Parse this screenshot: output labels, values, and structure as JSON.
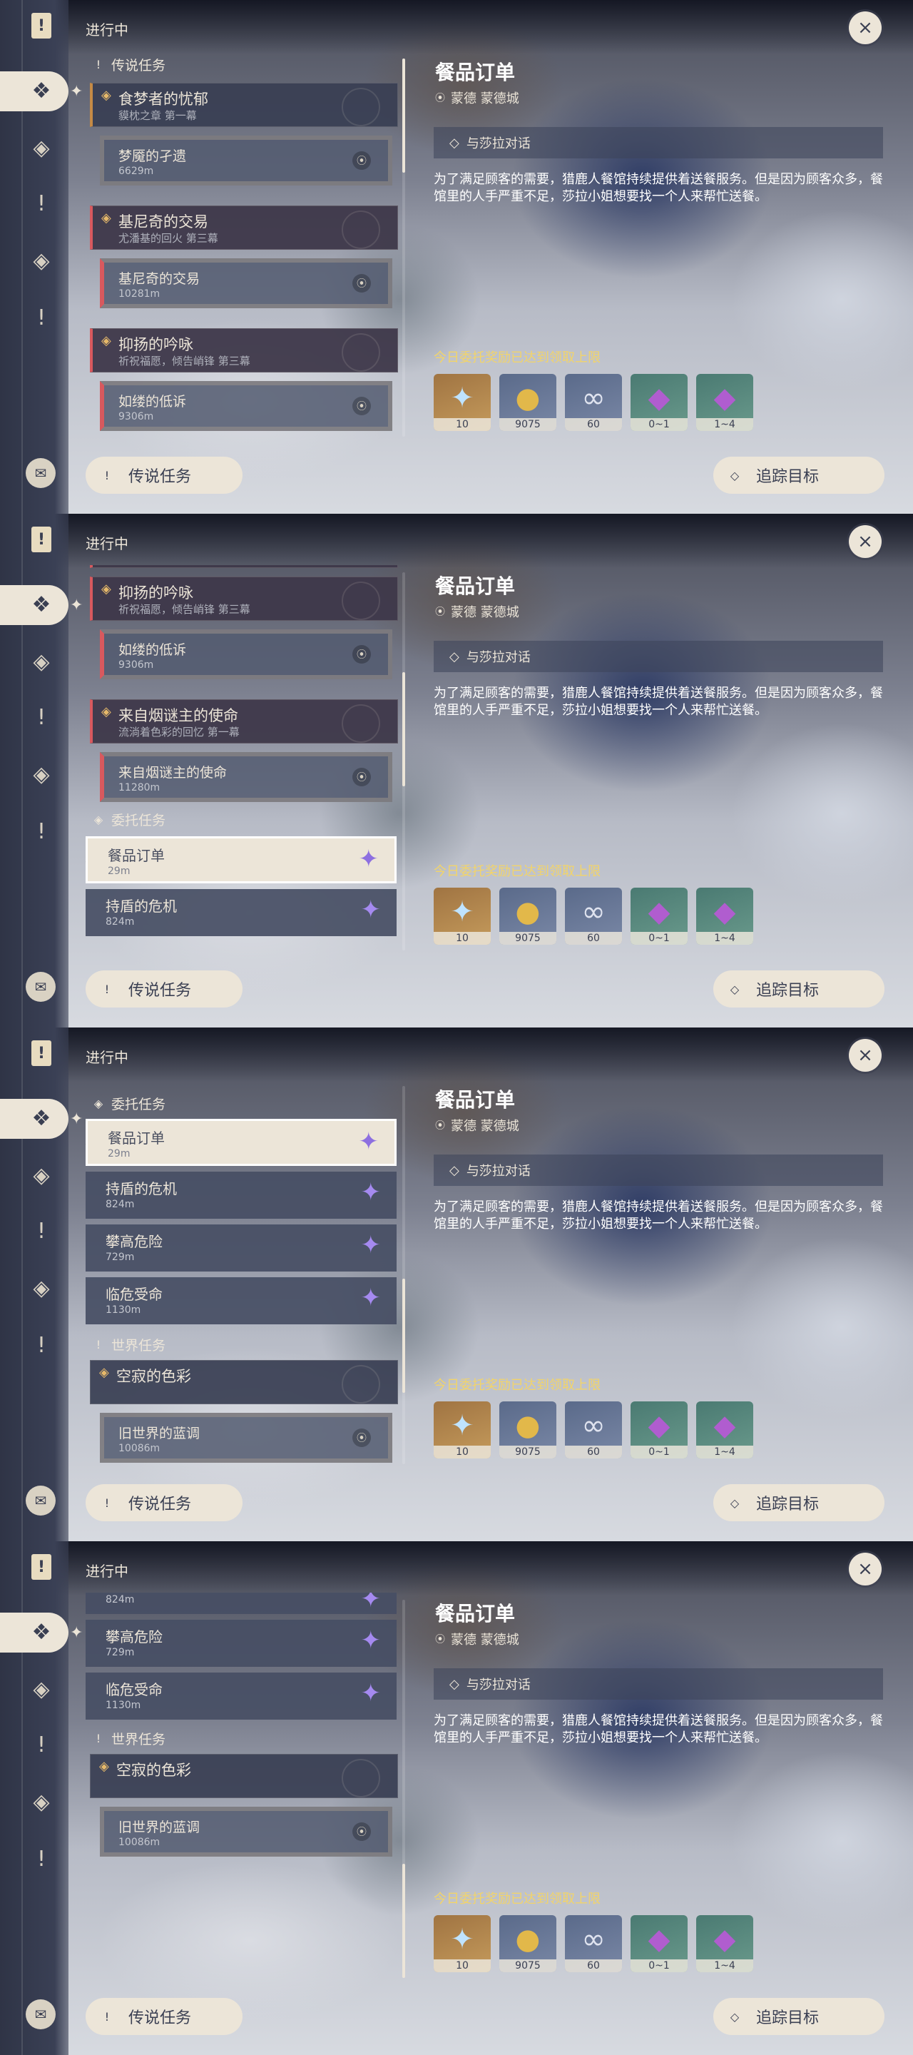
{
  "header": {
    "in_progress": "进行中",
    "close_icon": "×"
  },
  "categories": {
    "legend": "传说任务",
    "commission": "委托任务",
    "world": "世界任务"
  },
  "quests": {
    "q1": {
      "title": "食梦者的忧郁",
      "subtitle": "貘枕之章 第一幕",
      "step": "梦魇的孑遗",
      "dist": "6629m"
    },
    "q2": {
      "title": "基尼奇的交易",
      "subtitle": "尤潘基的回火 第三幕",
      "step": "基尼奇的交易",
      "dist": "10281m"
    },
    "q3": {
      "title": "抑扬的吟咏",
      "subtitle": "祈祝福愿，倾告峭锋 第三幕",
      "step": "如缕的低诉",
      "dist": "9306m"
    },
    "q4": {
      "title": "来自烟谜主的使命",
      "subtitle": "流淌着色彩的回忆 第一幕",
      "step": "来自烟谜主的使命",
      "dist": "11280m"
    },
    "w1": {
      "title": "空寂的色彩",
      "step": "旧世界的蓝调",
      "dist": "10086m"
    }
  },
  "commissions": [
    {
      "title": "餐品订单",
      "dist": "29m"
    },
    {
      "title": "持盾的危机",
      "dist": "824m"
    },
    {
      "title": "攀高危险",
      "dist": "729m"
    },
    {
      "title": "临危受命",
      "dist": "1130m"
    }
  ],
  "detail": {
    "title": "餐品订单",
    "location": "蒙德 蒙德城",
    "objective": "与莎拉对话",
    "description": "为了满足顾客的需要，猎鹿人餐馆持续提供着送餐服务。但是因为顾客众多，餐馆里的人手严重不足，莎拉小姐想要找一个人来帮忙送餐。",
    "limit_notice": "今日委托奖励已达到领取上限",
    "rewards": [
      {
        "icon": "primogem-icon",
        "count": "10"
      },
      {
        "icon": "mora-icon",
        "count": "9075"
      },
      {
        "icon": "adventure-exp-icon",
        "count": "60"
      },
      {
        "icon": "crystal-ore-icon",
        "count": "0~1"
      },
      {
        "icon": "crystal-chunk-icon",
        "count": "1~4"
      }
    ]
  },
  "buttons": {
    "legend_filter": "传说任务",
    "track": "追踪目标"
  }
}
